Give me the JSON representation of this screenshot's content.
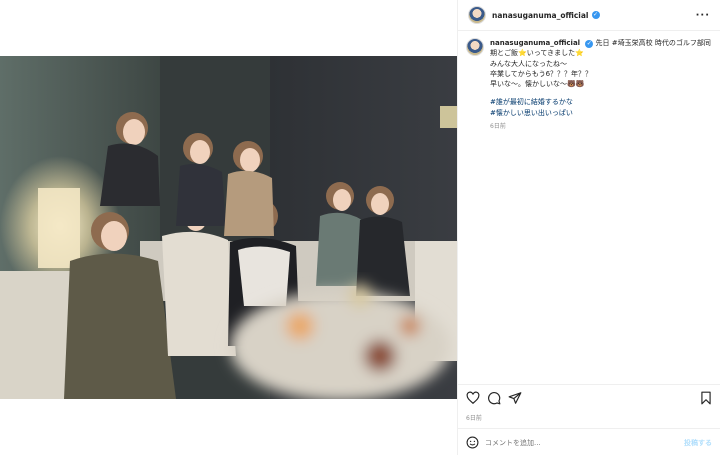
{
  "header": {
    "username": "nanasuganuma_official",
    "verified_icon": "verified-badge-icon",
    "more_label": "···"
  },
  "caption": {
    "username": "nanasuganuma_official",
    "lines": [
      "先日 #埼玉栄高校 時代のゴルフ部同",
      "期とご飯⭐️いってきました⭐️",
      "みんな大人になったね〜",
      "卒業してからもう6？？？年？？",
      "早いな〜。懐かしいな〜🐻🐻"
    ],
    "hashtags": [
      "#誰が最初に結婚するかな",
      "#懐かしい思い出いっぱい"
    ],
    "timestamp": "6日前"
  },
  "actions": {
    "like_icon": "heart-icon",
    "comment_icon": "comment-icon",
    "share_icon": "send-icon",
    "save_icon": "bookmark-icon"
  },
  "post_timestamp": "6日前",
  "comment_box": {
    "placeholder": "コメントを追加...",
    "emoji_icon": "emoji-icon",
    "post_label": "投稿する"
  },
  "colors": {
    "link": "#00376b",
    "muted": "#8e8e8e",
    "verified": "#3897f0",
    "post_button": "#b2dffc"
  }
}
